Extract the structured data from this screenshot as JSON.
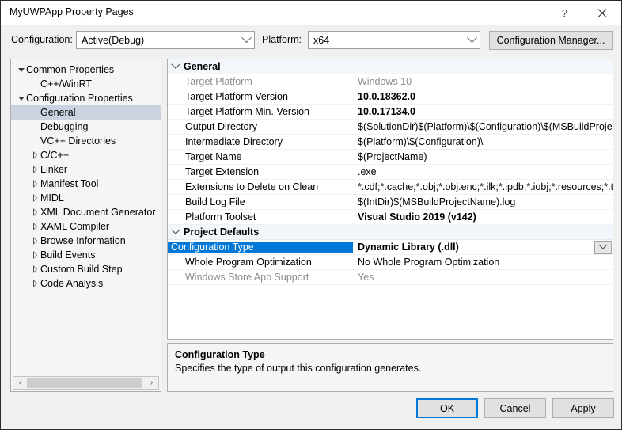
{
  "window": {
    "title": "MyUWPApp Property Pages",
    "help_icon": "?",
    "close_icon": "close-icon"
  },
  "toolbar": {
    "configuration_label": "Configuration:",
    "configuration_value": "Active(Debug)",
    "platform_label": "Platform:",
    "platform_value": "x64",
    "configuration_manager_label": "Configuration Manager..."
  },
  "tree": {
    "items": [
      {
        "label": "Common Properties",
        "indent": 0,
        "state": "expanded",
        "selected": false
      },
      {
        "label": "C++/WinRT",
        "indent": 1,
        "state": "leaf",
        "selected": false
      },
      {
        "label": "Configuration Properties",
        "indent": 0,
        "state": "expanded",
        "selected": false
      },
      {
        "label": "General",
        "indent": 1,
        "state": "leaf",
        "selected": true
      },
      {
        "label": "Debugging",
        "indent": 1,
        "state": "leaf",
        "selected": false
      },
      {
        "label": "VC++ Directories",
        "indent": 1,
        "state": "leaf",
        "selected": false
      },
      {
        "label": "C/C++",
        "indent": 1,
        "state": "collapsed",
        "selected": false
      },
      {
        "label": "Linker",
        "indent": 1,
        "state": "collapsed",
        "selected": false
      },
      {
        "label": "Manifest Tool",
        "indent": 1,
        "state": "collapsed",
        "selected": false
      },
      {
        "label": "MIDL",
        "indent": 1,
        "state": "collapsed",
        "selected": false
      },
      {
        "label": "XML Document Generator",
        "indent": 1,
        "state": "collapsed",
        "selected": false
      },
      {
        "label": "XAML Compiler",
        "indent": 1,
        "state": "collapsed",
        "selected": false
      },
      {
        "label": "Browse Information",
        "indent": 1,
        "state": "collapsed",
        "selected": false
      },
      {
        "label": "Build Events",
        "indent": 1,
        "state": "collapsed",
        "selected": false
      },
      {
        "label": "Custom Build Step",
        "indent": 1,
        "state": "collapsed",
        "selected": false
      },
      {
        "label": "Code Analysis",
        "indent": 1,
        "state": "collapsed",
        "selected": false
      }
    ],
    "scrollbar": {
      "left_arrow": "‹",
      "right_arrow": "›"
    }
  },
  "grid": {
    "rows": [
      {
        "kind": "section",
        "name": "General"
      },
      {
        "kind": "prop",
        "name": "Target Platform",
        "value": "Windows 10",
        "disabled": true,
        "bold": false,
        "selected": false,
        "dropdown": false
      },
      {
        "kind": "prop",
        "name": "Target Platform Version",
        "value": "10.0.18362.0",
        "disabled": false,
        "bold": true,
        "selected": false,
        "dropdown": false
      },
      {
        "kind": "prop",
        "name": "Target Platform Min. Version",
        "value": "10.0.17134.0",
        "disabled": false,
        "bold": true,
        "selected": false,
        "dropdown": false
      },
      {
        "kind": "prop",
        "name": "Output Directory",
        "value": "$(SolutionDir)$(Platform)\\$(Configuration)\\$(MSBuildProjectName)",
        "disabled": false,
        "bold": false,
        "selected": false,
        "dropdown": false
      },
      {
        "kind": "prop",
        "name": "Intermediate Directory",
        "value": "$(Platform)\\$(Configuration)\\",
        "disabled": false,
        "bold": false,
        "selected": false,
        "dropdown": false
      },
      {
        "kind": "prop",
        "name": "Target Name",
        "value": "$(ProjectName)",
        "disabled": false,
        "bold": false,
        "selected": false,
        "dropdown": false
      },
      {
        "kind": "prop",
        "name": "Target Extension",
        "value": ".exe",
        "disabled": false,
        "bold": false,
        "selected": false,
        "dropdown": false
      },
      {
        "kind": "prop",
        "name": "Extensions to Delete on Clean",
        "value": "*.cdf;*.cache;*.obj;*.obj.enc;*.ilk;*.ipdb;*.iobj;*.resources;*.tlb;*.tli",
        "disabled": false,
        "bold": false,
        "selected": false,
        "dropdown": false
      },
      {
        "kind": "prop",
        "name": "Build Log File",
        "value": "$(IntDir)$(MSBuildProjectName).log",
        "disabled": false,
        "bold": false,
        "selected": false,
        "dropdown": false
      },
      {
        "kind": "prop",
        "name": "Platform Toolset",
        "value": "Visual Studio 2019 (v142)",
        "disabled": false,
        "bold": true,
        "selected": false,
        "dropdown": false
      },
      {
        "kind": "section",
        "name": "Project Defaults"
      },
      {
        "kind": "prop",
        "name": "Configuration Type",
        "value": "Dynamic Library (.dll)",
        "disabled": false,
        "bold": true,
        "selected": true,
        "dropdown": true
      },
      {
        "kind": "prop",
        "name": "Whole Program Optimization",
        "value": "No Whole Program Optimization",
        "disabled": false,
        "bold": false,
        "selected": false,
        "dropdown": false
      },
      {
        "kind": "prop",
        "name": "Windows Store App Support",
        "value": "Yes",
        "disabled": true,
        "bold": false,
        "selected": false,
        "dropdown": false
      }
    ]
  },
  "description": {
    "title": "Configuration Type",
    "text": "Specifies the type of output this configuration generates."
  },
  "footer": {
    "ok_label": "OK",
    "cancel_label": "Cancel",
    "apply_label": "Apply"
  },
  "colors": {
    "selection_blue": "#0078d7",
    "tree_selection": "#cbd3e1",
    "dialog_bg": "#f0f0f0"
  }
}
